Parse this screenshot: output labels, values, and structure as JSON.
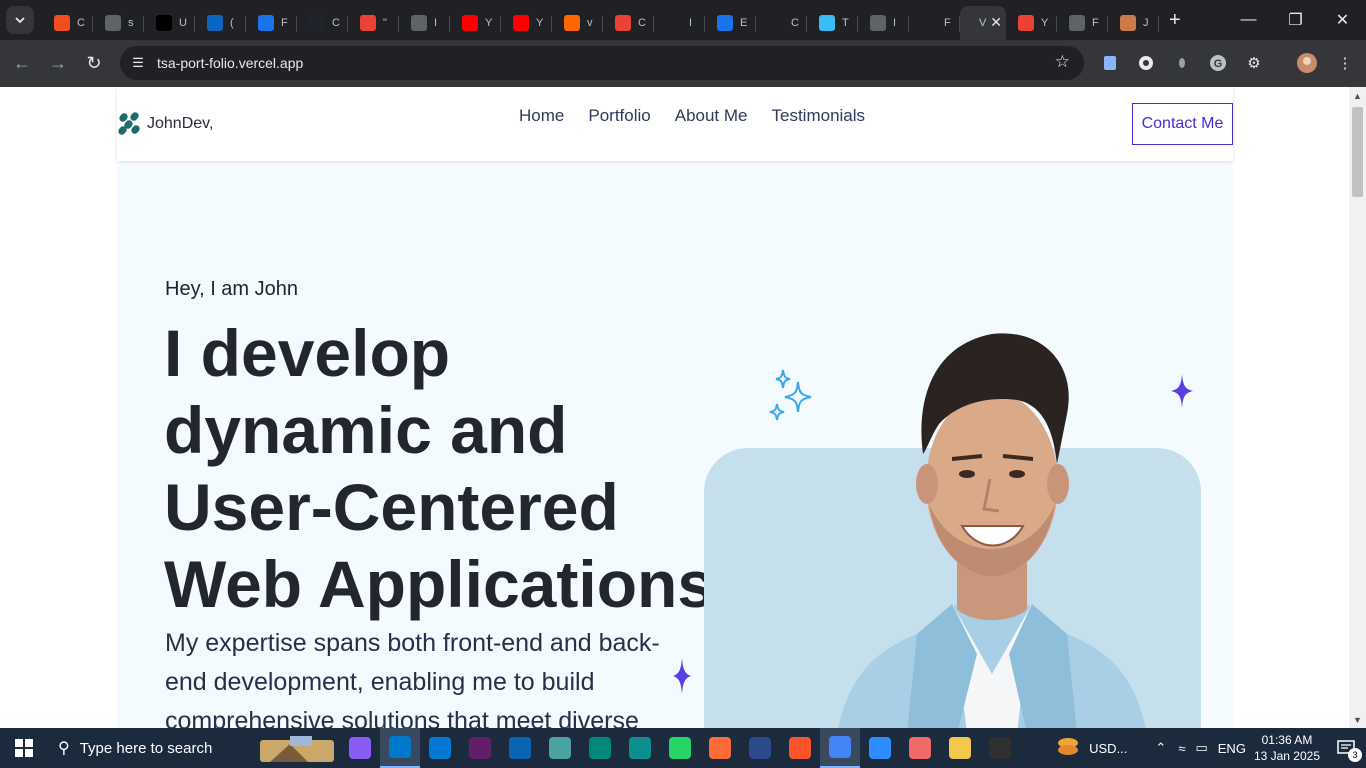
{
  "browser": {
    "tabs": [
      {
        "icon": "figma-icon",
        "title": "C",
        "color": "#f24e1e"
      },
      {
        "icon": "globe-icon",
        "title": "s",
        "color": "#5f6368"
      },
      {
        "icon": "upwork-icon",
        "title": "U",
        "color": "#000000"
      },
      {
        "icon": "linkedin-icon",
        "title": "(",
        "color": "#0a66c2"
      },
      {
        "icon": "flag-icon",
        "title": "F",
        "color": "#1a73e8"
      },
      {
        "icon": "react-icon",
        "title": "C",
        "color": "#20232a"
      },
      {
        "icon": "gmail-icon",
        "title": "\"",
        "color": "#ea4335"
      },
      {
        "icon": "globe-icon",
        "title": "I",
        "color": "#5f6368"
      },
      {
        "icon": "youtube-icon",
        "title": "Y",
        "color": "#ff0000"
      },
      {
        "icon": "youtube-icon",
        "title": "Y",
        "color": "#ff0000"
      },
      {
        "icon": "ycombinator-icon",
        "title": "v",
        "color": "#ff6600"
      },
      {
        "icon": "gmail-icon",
        "title": "C",
        "color": "#ea4335"
      },
      {
        "icon": "info-icon",
        "title": "I",
        "color": "#202124"
      },
      {
        "icon": "browser-icon",
        "title": "E",
        "color": "#1a73e8"
      },
      {
        "icon": "openai-icon",
        "title": "C",
        "color": "#202124"
      },
      {
        "icon": "tailwind-icon",
        "title": "T",
        "color": "#38bdf8"
      },
      {
        "icon": "globe-icon",
        "title": "I",
        "color": "#5f6368"
      },
      {
        "icon": "github-icon",
        "title": "F",
        "color": "#202124"
      }
    ],
    "active_tab": {
      "title": "V"
    },
    "after_tabs": [
      {
        "icon": "gmail-icon",
        "title": "Y",
        "color": "#ea4335"
      },
      {
        "icon": "globe-icon",
        "title": "F",
        "color": "#5f6368"
      },
      {
        "icon": "profile-icon",
        "title": "J",
        "color": "#c97a4a"
      }
    ],
    "url": "tsa-port-folio.vercel.app"
  },
  "site": {
    "logo_text": "JohnDev,",
    "nav": [
      "Home",
      "Portfolio",
      "About Me",
      "Testimonials"
    ],
    "contact_label": "Contact Me",
    "greeting": "Hey, I am John",
    "headline_lines": [
      "I develop",
      "dynamic and",
      "User-Centered",
      "Web Applications"
    ],
    "subtext": "My expertise spans both front-end and back-end development, enabling me to build comprehensive solutions that meet diverse",
    "colors": {
      "accent": "#4b2bd1",
      "sparkle_blue": "#3ba7e8",
      "hero_bg": "#f3fbff",
      "card_bg": "#c5dfec"
    }
  },
  "taskbar": {
    "search_placeholder": "Type here to search",
    "apps": [
      {
        "icon": "copilot-icon",
        "color": "#8a5cf6"
      },
      {
        "icon": "vscode-icon",
        "color": "#007acc",
        "active": true
      },
      {
        "icon": "store-icon",
        "color": "#0078d4"
      },
      {
        "icon": "slack-icon",
        "color": "#611f69"
      },
      {
        "icon": "outlook-icon",
        "color": "#0a64b4"
      },
      {
        "icon": "git-tool-icon",
        "color": "#4aa3a3"
      },
      {
        "icon": "meet-icon",
        "color": "#00897b"
      },
      {
        "icon": "edge-icon",
        "color": "#0c8f8f"
      },
      {
        "icon": "whatsapp-icon",
        "color": "#25d366"
      },
      {
        "icon": "postman-icon",
        "color": "#ff6c37"
      },
      {
        "icon": "figure-icon",
        "color": "#2c4a8a"
      },
      {
        "icon": "brave-icon",
        "color": "#fb542b"
      },
      {
        "icon": "chrome-icon",
        "color": "#4285f4",
        "active": true
      },
      {
        "icon": "zoom-icon",
        "color": "#2d8cff"
      },
      {
        "icon": "asana-icon",
        "color": "#f06a6a"
      },
      {
        "icon": "file-explorer-icon",
        "color": "#f2c94c"
      },
      {
        "icon": "obs-icon",
        "color": "#303030"
      }
    ],
    "ticker": "USD...",
    "language": "ENG",
    "time": "01:36 AM",
    "date": "13 Jan 2025",
    "notifications": "3"
  }
}
